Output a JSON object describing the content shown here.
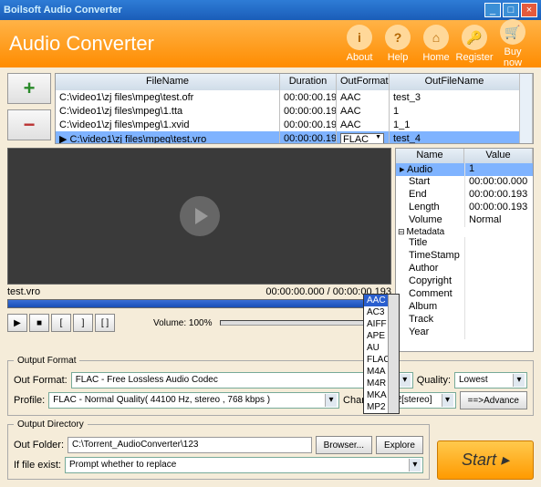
{
  "title": "Boilsoft Audio Converter",
  "header": {
    "title": "Audio Converter",
    "buttons": [
      "About",
      "Help",
      "Home",
      "Register",
      "Buy now"
    ],
    "icons": [
      "i",
      "?",
      "⌂",
      "🔑",
      "🛒"
    ]
  },
  "table": {
    "headers": {
      "fn": "FileName",
      "dur": "Duration",
      "of": "OutFormat",
      "ofn": "OutFileName"
    },
    "rows": [
      {
        "fn": "C:\\video1\\zj files\\mpeg\\test.ofr",
        "dur": "00:00:00.193",
        "of": "AAC",
        "ofn": "test_3"
      },
      {
        "fn": "C:\\video1\\zj files\\mpeg\\1.tta",
        "dur": "00:00:00.193",
        "of": "AAC",
        "ofn": "1"
      },
      {
        "fn": "C:\\video1\\zj files\\mpeg\\1.xvid",
        "dur": "00:00:00.193",
        "of": "AAC",
        "ofn": "1_1"
      },
      {
        "fn": "C:\\video1\\zj files\\mpeg\\test.vro",
        "dur": "00:00:00.193",
        "of": "FLAC",
        "ofn": "test_4"
      }
    ]
  },
  "dropdown": [
    "AAC",
    "AC3",
    "AIFF",
    "APE",
    "AU",
    "FLAC",
    "M4A",
    "M4R",
    "MKA",
    "MP2"
  ],
  "props": {
    "headers": {
      "name": "Name",
      "value": "Value"
    },
    "audio": {
      "label": "Audio",
      "value": "1"
    },
    "rows": [
      {
        "n": "Start",
        "v": "00:00:00.000"
      },
      {
        "n": "End",
        "v": "00:00:00.193"
      },
      {
        "n": "Length",
        "v": "00:00:00.193"
      },
      {
        "n": "Volume",
        "v": "Normal"
      }
    ],
    "meta_label": "Metadata",
    "meta": [
      "Title",
      "TimeStamp",
      "Author",
      "Copyright",
      "Comment",
      "Album",
      "Track",
      "Year"
    ]
  },
  "preview": {
    "file": "test.vro",
    "time": "00:00:00.000 / 00:00:00.193",
    "volume": "Volume: 100%"
  },
  "outfmt": {
    "legend": "Output Format",
    "format_label": "Out Format:",
    "format": "FLAC - Free Lossless Audio Codec",
    "quality_label": "Quality:",
    "quality": "Lowest",
    "profile_label": "Profile:",
    "profile": "FLAC - Normal Quality( 44100 Hz, stereo , 768 kbps )",
    "channels_label": "Channels:",
    "channels": "2[stereo]",
    "advance": "==>Advance"
  },
  "outdir": {
    "legend": "Output Directory",
    "folder_label": "Out Folder:",
    "folder": "C:\\Torrent_AudioConverter\\123",
    "browse": "Browser...",
    "explore": "Explore",
    "exist_label": "If file exist:",
    "exist": "Prompt whether to replace"
  },
  "start": "Start"
}
